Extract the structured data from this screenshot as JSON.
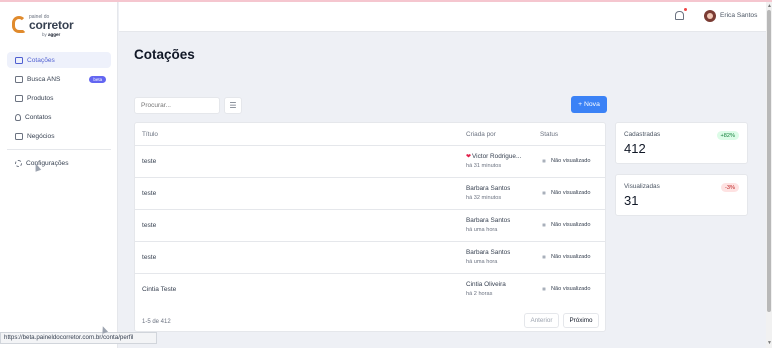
{
  "brand": {
    "small_text": "painel do",
    "name": "corretor",
    "by": "by",
    "by_brand": "agger"
  },
  "sidebar": {
    "items": [
      {
        "label": "Cotações",
        "icon": "folder-icon"
      },
      {
        "label": "Busca ANS",
        "icon": "folder-icon",
        "badge": "beta"
      },
      {
        "label": "Produtos",
        "icon": "stack-icon"
      },
      {
        "label": "Contatos",
        "icon": "user-icon"
      },
      {
        "label": "Negócios",
        "icon": "briefcase-icon"
      }
    ],
    "settings_label": "Configurações"
  },
  "header": {
    "user_name": "Erica Santos"
  },
  "page": {
    "title": "Cotações",
    "search_placeholder": "Procurar...",
    "new_button": "+ Nova"
  },
  "table": {
    "columns": [
      "Título",
      "Criada por",
      "Status"
    ],
    "rows": [
      {
        "title": "teste",
        "created_by": "Victor Rodrigue...",
        "time": "há 31 minutos",
        "status": "Não visualizado",
        "has_heart": true
      },
      {
        "title": "teste",
        "created_by": "Barbara Santos",
        "time": "há 32 minutos",
        "status": "Não visualizado"
      },
      {
        "title": "teste",
        "created_by": "Barbara Santos",
        "time": "há uma hora",
        "status": "Não visualizado"
      },
      {
        "title": "teste",
        "created_by": "Barbara Santos",
        "time": "há uma hora",
        "status": "Não visualizado"
      },
      {
        "title": "Cintia Teste",
        "created_by": "Cintia Oliveira",
        "time": "há 2 horas",
        "status": "Não visualizado"
      }
    ],
    "pagination": {
      "count": "1-5 de 412",
      "prev": "Anterior",
      "next": "Próximo"
    }
  },
  "stats": [
    {
      "label": "Cadastradas",
      "value": "412",
      "change": "+82%",
      "trend": "up"
    },
    {
      "label": "Visualizadas",
      "value": "31",
      "change": "-3%",
      "trend": "down"
    }
  ],
  "status_url": "https://beta.paineldocorretor.com.br/conta/perfil",
  "colors": {
    "accent": "#3b82f6",
    "active_nav_bg": "#eef1fb",
    "beta_badge": "#6366f1"
  }
}
